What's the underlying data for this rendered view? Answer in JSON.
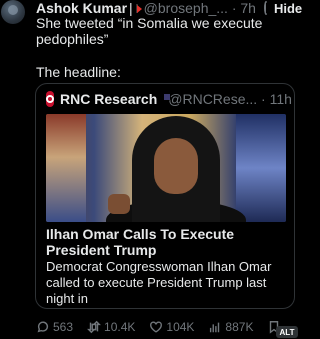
{
  "tweet": {
    "author_name": "Ashok Kumar",
    "separator": "|",
    "handle_time": "@broseph_... · 7h",
    "hide_label": "Hide",
    "text": "She tweeted “in Somalia we execute\npedophiles”",
    "text2": "The headline:"
  },
  "quote": {
    "name": "RNC Research",
    "handle_time": "@RNCRese... · 11h",
    "title": "Ilhan Omar Calls To Execute\nPresident Trump",
    "body": "Democrat Congresswoman Ilhan Omar\ncalled to execute President Trump last night in\na deeply unsettling tweet."
  },
  "actions": {
    "replies": "563",
    "retweets": "10.4K",
    "likes": "104K",
    "views": "887K"
  },
  "alt_label": "ALT",
  "colors": {
    "background": "#000000",
    "text": "#e7e9ea",
    "muted": "#71767b",
    "border": "#2f3336",
    "rnc_red": "#c8102e"
  },
  "icons": [
    "avatar",
    "flag-icon",
    "refresh-icon",
    "rnc-logo-icon",
    "verified-icon",
    "us-flag-icon",
    "reply-icon",
    "retweet-icon",
    "like-icon",
    "views-icon",
    "bookmark-icon"
  ]
}
